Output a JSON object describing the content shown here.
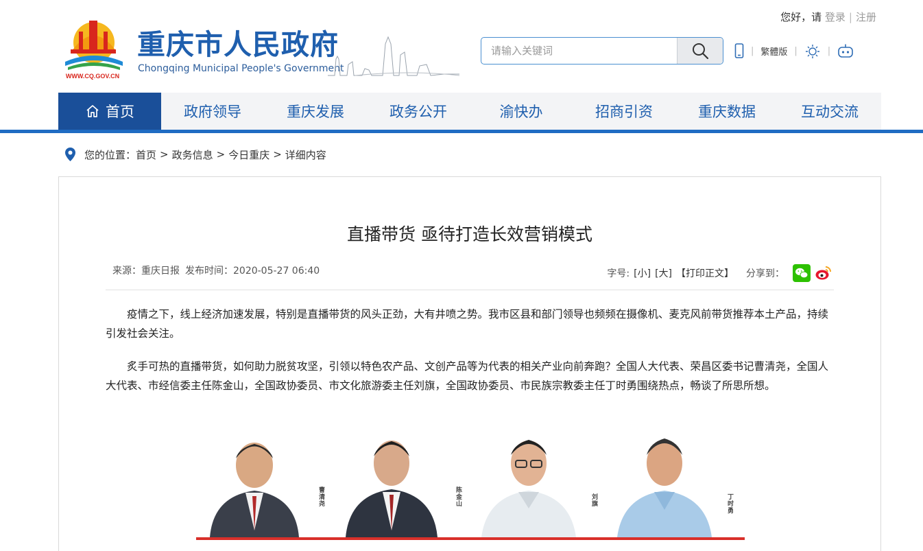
{
  "header": {
    "greeting": "您好，请",
    "login": "登录",
    "register": "注册",
    "site_name": "重庆市人民政府",
    "site_name_en": "Chongqing Municipal People's Government",
    "logo_url_text": "WWW.CQ.GOV.CN",
    "search": {
      "placeholder": "请输入关键词",
      "value": ""
    },
    "tools": {
      "traditional": "繁體版"
    }
  },
  "nav": {
    "items": [
      {
        "label": "首页",
        "active": true
      },
      {
        "label": "政府领导"
      },
      {
        "label": "重庆发展"
      },
      {
        "label": "政务公开"
      },
      {
        "label": "渝快办"
      },
      {
        "label": "招商引资"
      },
      {
        "label": "重庆数据"
      },
      {
        "label": "互动交流"
      }
    ]
  },
  "breadcrumb": {
    "prefix": "您的位置：",
    "items": [
      "首页",
      "政务信息",
      "今日重庆",
      "详细内容"
    ]
  },
  "article": {
    "title": "直播带货 亟待打造长效营销模式",
    "source": "来源：重庆日报",
    "publish_time": "发布时间：2020-05-27 06:40",
    "font_size_label": "字号:",
    "font_small": "[小]",
    "font_large": "[大]",
    "print": "【打印正文】",
    "share_label": "分享到：",
    "paragraphs": [
      "疫情之下，线上经济加速发展，特别是直播带货的风头正劲，大有井喷之势。我市区县和部门领导也频频在摄像机、麦克风前带货推荐本土产品，持续引发社会关注。",
      "炙手可热的直播带货，如何助力脱贫攻坚，引领以特色农产品、文创产品等为代表的相关产业向前奔跑？全国人大代表、荣昌区委书记曹清尧，全国人大代表、市经信委主任陈金山，全国政协委员、市文化旅游委主任刘旗，全国政协委员、市民族宗教委主任丁时勇围绕热点，畅谈了所思所想。"
    ],
    "figure_captions": [
      "曹清尧",
      "陈金山",
      "刘旗",
      "丁时勇"
    ]
  },
  "colors": {
    "brand_blue": "#1f5fae",
    "nav_active": "#1a4f99",
    "accent_red": "#d9302a"
  }
}
